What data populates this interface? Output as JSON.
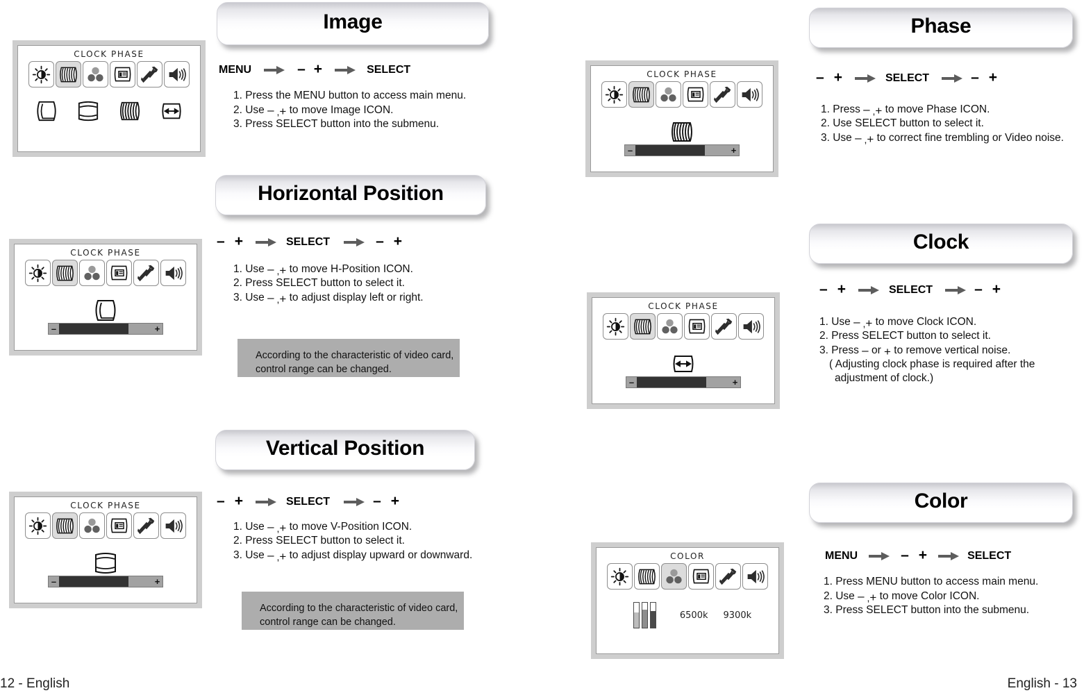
{
  "footer": {
    "left": "12 - English",
    "right": "English - 13"
  },
  "labels": {
    "menu": "MENU",
    "select": "SELECT",
    "minus": "–",
    "plus": "+",
    "comma": ","
  },
  "osd_titles": {
    "clock_phase": "CLOCK PHASE",
    "color": "COLOR"
  },
  "color_osd": {
    "temp_6500": "6500k",
    "temp_9300": "9300k"
  },
  "notes": {
    "video_card_line1": "According to the characteristic of video card,",
    "video_card_line2": "control range can be changed."
  },
  "sections": [
    {
      "id": "image",
      "title": "Image",
      "steps": [
        "1. Press the MENU button to access main menu.",
        "2. Use – , + to move  Image ICON.",
        "3. Press SELECT button into the submenu."
      ],
      "step1_pre": "1. Press the MENU button to access main menu.",
      "step2_pre": "2. Use ",
      "step2_post": " to move  Image ICON.",
      "step3": "3. Press SELECT button into the submenu."
    },
    {
      "id": "horizontal-position",
      "title": "Horizontal Position",
      "step1_pre": "1. Use ",
      "step1_post": " to move  H-Position ICON.",
      "step2": "2. Press SELECT button to select it.",
      "step3_pre": "3. Use ",
      "step3_post": " to adjust display left or right."
    },
    {
      "id": "vertical-position",
      "title": "Vertical Position",
      "step1_pre": "1. Use ",
      "step1_post": " to move V-Position ICON.",
      "step2": "2.  Press SELECT button to select it.",
      "step3_pre": "3. Use ",
      "step3_post": " to adjust display upward or downward."
    },
    {
      "id": "phase",
      "title": "Phase",
      "step1_pre": "1. Press ",
      "step1_post": " to move Phase ICON.",
      "step2": "2. Use SELECT button to select it.",
      "step3_pre": "3. Use ",
      "step3_post": " to correct fine trembling or Video noise."
    },
    {
      "id": "clock",
      "title": "Clock",
      "step1_pre": "1. Use ",
      "step1_post": " to move Clock ICON.",
      "step2": "2. Press SELECT button to select it.",
      "step3_a": "3. Press ",
      "step3_or": " or ",
      "step3_b": " to remove vertical noise.",
      "step3_sub1": "( Adjusting clock phase is required after the",
      "step3_sub2": "adjustment of clock.)"
    },
    {
      "id": "color",
      "title": "Color",
      "step1": "1. Press MENU button to access main menu.",
      "step2_pre": "2. Use ",
      "step2_post": " to move Color ICON.",
      "step3": "3. Press SELECT button into the submenu."
    }
  ],
  "colors": {
    "osd_frame": "#cecece",
    "note_bg": "#adadad",
    "tile_selected": "#dcdcdc",
    "bar_fill": "#333333",
    "bar_track": "#a2a2a2",
    "arrow": "#5d5d5d"
  }
}
